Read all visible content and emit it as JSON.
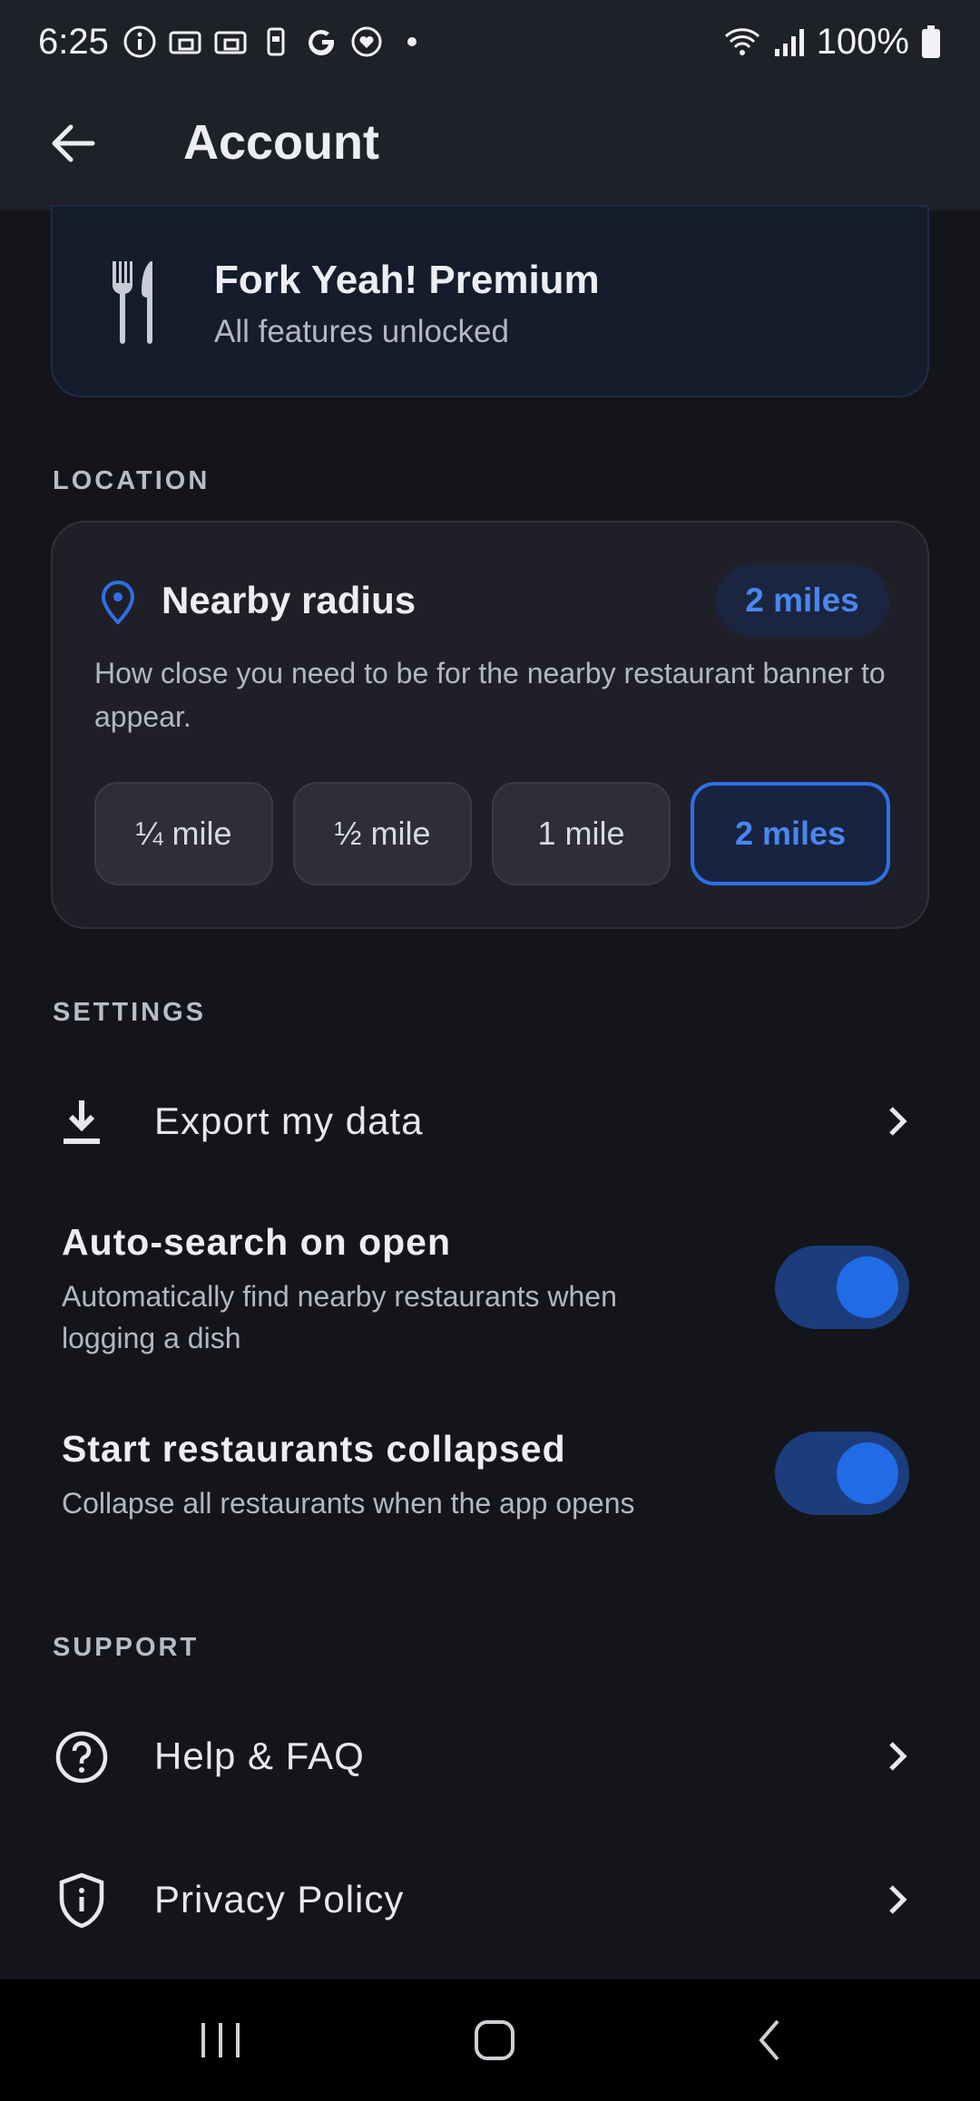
{
  "status_bar": {
    "time": "6:25",
    "battery": "100%",
    "icons": [
      "info-icon",
      "cast-icon",
      "cast-icon",
      "phone-icon",
      "google-icon",
      "heart-badge-icon",
      "dot-icon",
      "wifi-icon",
      "signal-icon",
      "battery-icon"
    ]
  },
  "app_bar": {
    "title": "Account",
    "back_icon": "arrow-left-icon"
  },
  "premium": {
    "icon": "fork-knife-icon",
    "title": "Fork Yeah! Premium",
    "subtitle": "All features unlocked"
  },
  "location": {
    "section_label": "LOCATION",
    "title": "Nearby radius",
    "badge": "2 miles",
    "description": "How close you need to be for the nearby restaurant banner to appear.",
    "options": [
      "¼ mile",
      "½ mile",
      "1 mile",
      "2 miles"
    ],
    "selected": "2 miles"
  },
  "settings": {
    "section_label": "SETTINGS",
    "export_label": "Export my data",
    "auto_search": {
      "title": "Auto-search on open",
      "description": "Automatically find nearby restaurants when logging a dish",
      "enabled": true
    },
    "collapsed": {
      "title": "Start restaurants collapsed",
      "description": "Collapse all restaurants when the app opens",
      "enabled": true
    }
  },
  "support": {
    "section_label": "SUPPORT",
    "help_label": "Help & FAQ",
    "privacy_label": "Privacy Policy"
  },
  "colors": {
    "accent": "#226be6",
    "background": "#14151b",
    "card": "#1f2027"
  }
}
